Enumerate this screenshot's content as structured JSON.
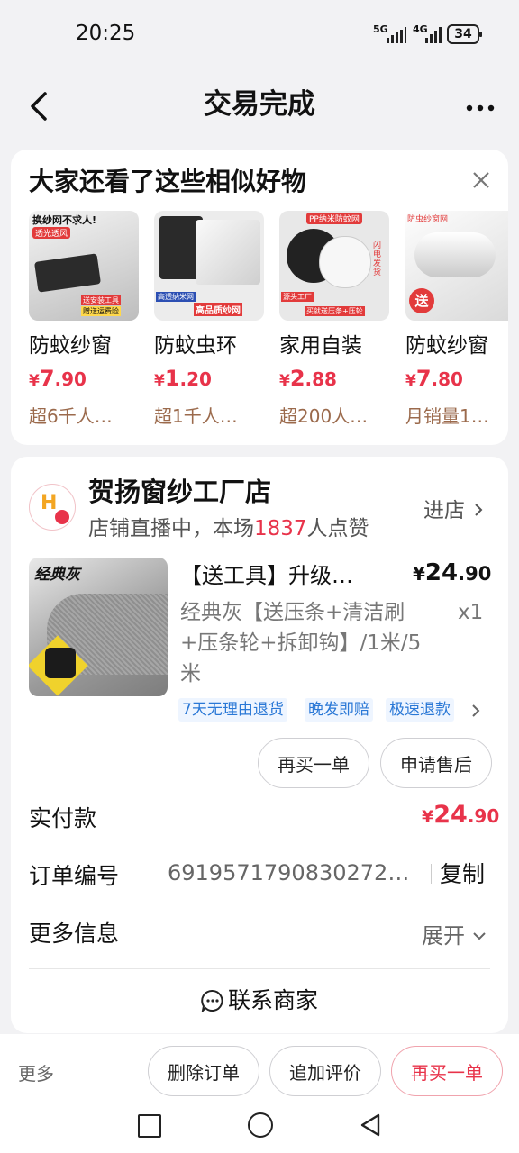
{
  "status_bar": {
    "time": "20:25",
    "net1": "5G",
    "net2": "4G",
    "battery": "34"
  },
  "header": {
    "title": "交易完成"
  },
  "recommend": {
    "title": "大家还看了这些相似好物",
    "items": [
      {
        "name": "防蚊纱窗",
        "price_symbol": "¥",
        "price_int": "7",
        "price_dec": ".90",
        "sales": "超6千人…",
        "img_top_text": "换纱网不求人!",
        "img_badge": "透光透风",
        "img_bottom": "送安装工具",
        "img_bottom2": "赠送运费险"
      },
      {
        "name": "防蚊虫环",
        "price_symbol": "¥",
        "price_int": "1",
        "price_dec": ".20",
        "sales": "超1千人…",
        "img_bottom": "高品质纱网",
        "img_bottom2": "高透纳米网"
      },
      {
        "name": "家用自装",
        "price_symbol": "¥",
        "price_int": "2",
        "price_dec": ".88",
        "sales": "超200人…",
        "img_top_text": "PP纳米防蚊网",
        "img_bottom": "买就送压条+压轮",
        "img_bottom2": "源头工厂",
        "img_side": "闪电发货"
      },
      {
        "name": "防蚊纱窗",
        "price_symbol": "¥",
        "price_int": "7",
        "price_dec": ".80",
        "sales": "月销量1…",
        "img_top_text": "防虫纱窗网",
        "img_badge": "送"
      }
    ]
  },
  "shop": {
    "name": "贺扬窗纱工厂店",
    "live_prefix": "店铺直播中，本场",
    "live_count": "1837",
    "live_suffix": "人点赞",
    "enter_label": "进店",
    "logo_letter": "H"
  },
  "product": {
    "img_label": "经典灰",
    "title": "【送工具】升级…",
    "price_symbol": "¥",
    "price_int": "24",
    "price_dec": ".90",
    "spec": "经典灰【送压条+清洁刷+压条轮+拆卸钩】/1米/5米",
    "qty": "x1",
    "tags": [
      "7天无理由退货",
      "晚发即赔",
      "极速退款"
    ],
    "btn_rebuy": "再买一单",
    "btn_aftersale": "申请售后"
  },
  "order": {
    "paid_label": "实付款",
    "paid_symbol": "¥",
    "paid_int": "24",
    "paid_dec": ".90",
    "order_no_label": "订单编号",
    "order_no": "6919571790830272…",
    "copy_label": "复制",
    "more_label": "更多信息",
    "expand_label": "展开",
    "contact_label": "联系商家"
  },
  "bottom_bar": {
    "more": "更多",
    "delete": "删除订单",
    "review": "追加评价",
    "rebuy": "再买一单"
  },
  "colors": {
    "accent": "#e8334a",
    "tag_blue": "#2a78d6",
    "bg": "#f2f2f4",
    "brown": "#9b6a4c"
  }
}
